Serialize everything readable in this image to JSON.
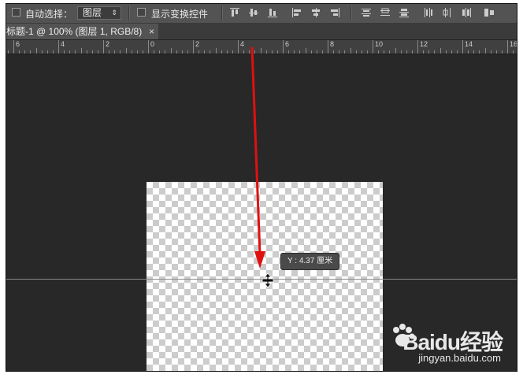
{
  "options_bar": {
    "auto_select_label": "自动选择：",
    "layer_select_value": "图层",
    "show_transform_label": "显示变换控件"
  },
  "document": {
    "tab_title": "标题-1 @ 100% (图层 1, RGB/8)",
    "close_glyph": "×"
  },
  "ruler": {
    "labels": [
      "6",
      "4",
      "2",
      "0",
      "2",
      "4",
      "6",
      "8",
      "10",
      "12",
      "14",
      "16"
    ]
  },
  "tooltip": {
    "text": "Y : 4.37 厘米"
  },
  "watermark": {
    "brand": "Baidu经验",
    "site": "jingyan.baidu.com"
  },
  "colors": {
    "annotation_arrow": "#e01010",
    "canvas_bg": "#282828",
    "panel_bg": "#535353"
  }
}
